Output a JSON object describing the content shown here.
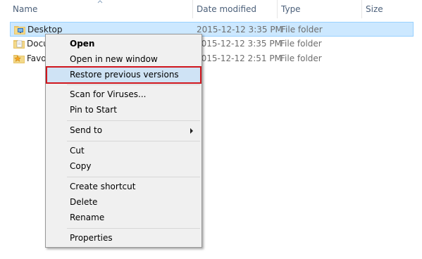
{
  "columns": {
    "name": "Name",
    "date_modified": "Date modified",
    "type": "Type",
    "size": "Size"
  },
  "rows": [
    {
      "name": "Desktop",
      "date": "2015-12-12 3:35 PM",
      "type": "File folder",
      "icon": "desktop-folder-icon",
      "selected": true
    },
    {
      "name": "Docu",
      "date": "2015-12-12 3:35 PM",
      "type": "File folder",
      "icon": "documents-folder-icon"
    },
    {
      "name": "Favo",
      "date": "2015-12-12 2:51 PM",
      "type": "File folder",
      "icon": "favorites-folder-icon"
    }
  ],
  "context_menu": {
    "items": [
      {
        "label": "Open",
        "bold": true
      },
      {
        "label": "Open in new window"
      },
      {
        "label": "Restore previous versions",
        "highlighted": true
      },
      {
        "label": "Scan for Viruses..."
      },
      {
        "label": "Pin to Start"
      },
      {
        "label": "Send to",
        "submenu": true
      },
      {
        "label": "Cut"
      },
      {
        "label": "Copy"
      },
      {
        "label": "Create shortcut"
      },
      {
        "label": "Delete"
      },
      {
        "label": "Rename"
      },
      {
        "label": "Properties"
      }
    ]
  },
  "colors": {
    "selection_bg": "#cce8ff",
    "highlight_border": "#d0161d",
    "menu_bg": "#f0f0f0"
  }
}
